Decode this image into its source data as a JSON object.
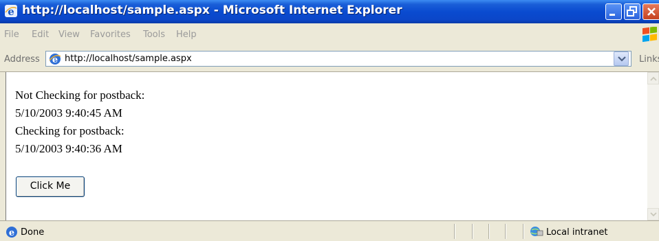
{
  "window": {
    "title": "http://localhost/sample.aspx - Microsoft Internet Explorer"
  },
  "menu": {
    "items": [
      "File",
      "Edit",
      "View",
      "Favorites",
      "Tools",
      "Help"
    ]
  },
  "address": {
    "label": "Address",
    "url": "http://localhost/sample.aspx",
    "links_label": "Links"
  },
  "content": {
    "lines": [
      "Not Checking for postback:",
      "5/10/2003 9:40:45 AM",
      "Checking for postback:",
      "5/10/2003 9:40:36 AM"
    ],
    "button_label": "Click Me"
  },
  "status": {
    "text": "Done",
    "zone": "Local intranet"
  },
  "colors": {
    "titlebar": "#0a4bd0",
    "chrome": "#ece9d8",
    "close_button": "#c5411f"
  }
}
